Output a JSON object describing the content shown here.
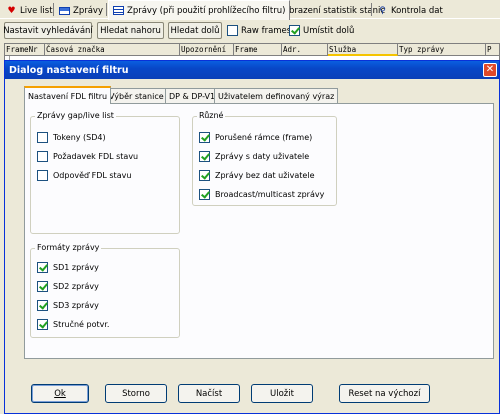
{
  "tabs": [
    {
      "label": "Live list",
      "icon": "heart-icon"
    },
    {
      "label": "Zprávy",
      "icon": "window-icon"
    },
    {
      "label": "Zprávy (při použití prohlížecího filtru)",
      "icon": "table-icon",
      "active": true
    },
    {
      "label": "Zobrazení statistik stanic",
      "icon": "globe-icon"
    },
    {
      "label": "Kontrola dat",
      "icon": "search-icon"
    }
  ],
  "toolbar": {
    "set_search": "Nastavit vyhledávání",
    "find_up": "Hledat nahoru",
    "find_down": "Hledat dolů",
    "raw_frames": {
      "label": "Raw frames",
      "checked": false
    },
    "place_below": {
      "label": "Umístit dolů",
      "checked": true
    }
  },
  "grid": {
    "columns": [
      "FrameNr",
      "Časová značka",
      "Upozornění",
      "Frame",
      "Adr.",
      "Služba",
      "Typ zprávy",
      "P"
    ]
  },
  "dialog": {
    "title": "Dialog nastavení filtru",
    "close_symbol": "✕",
    "tabs": [
      "Nastavení FDL filtru",
      "Výběr stanice",
      "DP & DP-V1",
      "Uživatelem definovaný výraz"
    ],
    "groups": {
      "gap": {
        "title": "Zprávy gap/live list",
        "options": [
          {
            "label": "Tokeny (SD4)",
            "checked": false
          },
          {
            "label": "Požadavek FDL stavu",
            "checked": false
          },
          {
            "label": "Odpověď FDL stavu",
            "checked": false
          }
        ]
      },
      "misc": {
        "title": "Různé",
        "options": [
          {
            "label": "Porušené rámce (frame)",
            "checked": true
          },
          {
            "label": "Zprávy s daty uživatele",
            "checked": true
          },
          {
            "label": "Zprávy bez dat uživatele",
            "checked": true
          },
          {
            "label": "Broadcast/multicast zprávy",
            "checked": true
          }
        ]
      },
      "formats": {
        "title": "Formáty zprávy",
        "options": [
          {
            "label": "SD1 zprávy",
            "checked": true
          },
          {
            "label": "SD2 zprávy",
            "checked": true
          },
          {
            "label": "SD3 zprávy",
            "checked": true
          },
          {
            "label": "Stručné potvr.",
            "checked": true
          }
        ]
      }
    },
    "buttons": {
      "ok": "Ok",
      "cancel": "Storno",
      "load": "Načíst",
      "save": "Uložit",
      "reset": "Reset na výchozí"
    }
  },
  "colors": {
    "titlebar": "#0a4fd0",
    "check": "#21a121",
    "active_tab_accent": "#f5a000"
  }
}
